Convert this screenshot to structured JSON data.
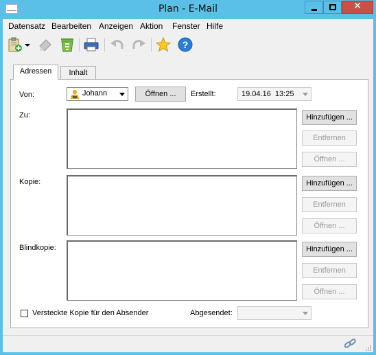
{
  "window": {
    "title": "Plan - E-Mail",
    "close_glyph": "✕"
  },
  "menu": [
    "Datensatz",
    "Bearbeiten",
    "Anzeigen",
    "Aktion",
    "Fenster",
    "Hilfe"
  ],
  "toolbar": {
    "icons": [
      "new-from-clipboard-icon",
      "dropdown-arrow-icon",
      "eraser-icon",
      "recycle-bin-icon",
      "print-icon",
      "undo-icon",
      "redo-icon",
      "favorite-star-icon",
      "help-icon"
    ]
  },
  "tabs": [
    "Adressen",
    "Inhalt"
  ],
  "form": {
    "von_label": "Von:",
    "von_value": "Johann",
    "open_button": "Öffnen ...",
    "created_label": "Erstellt:",
    "created_value": "19.04.16  13:25",
    "zu_label": "Zu:",
    "kopie_label": "Kopie:",
    "blind_label": "Blindkopie:",
    "add_button": "Hinzufügen ...",
    "remove_button": "Entfernen",
    "open_disabled_button": "Öffnen ...",
    "hidden_copy_label": "Versteckte Kopie für den Absender",
    "sent_label": "Abgesendet:",
    "sent_value": ""
  },
  "colors": {
    "titlebar": "#5ac0e8",
    "close": "#c7514a"
  }
}
